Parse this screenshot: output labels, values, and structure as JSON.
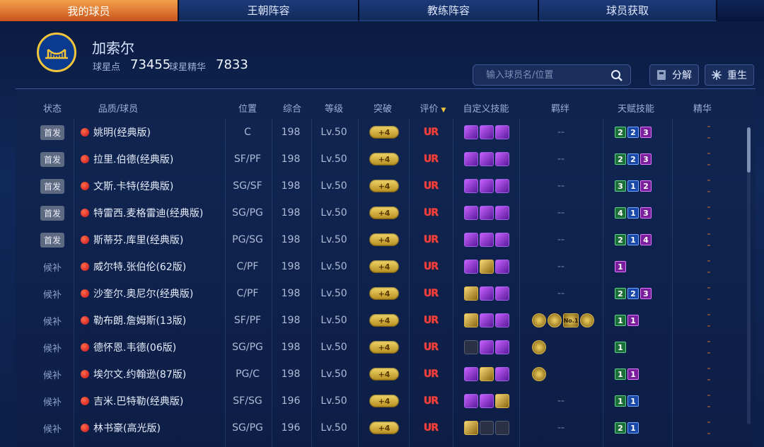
{
  "tabs": [
    {
      "label": "我的球员"
    },
    {
      "label": "王朝阵容"
    },
    {
      "label": "教练阵容"
    },
    {
      "label": "球员获取"
    }
  ],
  "header": {
    "team_name": "加索尔",
    "star_points_label": "球星点",
    "star_points_value": "73455",
    "essence_label": "球星精华",
    "essence_value": "7833"
  },
  "search": {
    "placeholder": "输入球员名/位置"
  },
  "buttons": {
    "split": "分解",
    "reborn": "重生"
  },
  "columns": {
    "status": "状态",
    "quality_player": "品质/球员",
    "position": "位置",
    "overall": "综合",
    "level": "等级",
    "breakthrough": "突破",
    "rating": "评价",
    "custom_skills": "自定义技能",
    "bonds": "羁绊",
    "talent_skills": "天赋技能",
    "essence": "精华"
  },
  "colors": {
    "accent_tab": "#e07a2e",
    "ur_red": "#ff3b3b",
    "gold": "#d8b34a"
  },
  "players": [
    {
      "status": "首发",
      "name": "姚明(经典版)",
      "pos": "C",
      "ovr": "198",
      "lvl": "Lv.50",
      "break": "+4",
      "rating": "UR",
      "bond": "--",
      "talents": [
        "2",
        "2",
        "3"
      ],
      "tc": [
        "g",
        "b",
        "p"
      ],
      "essence": "--"
    },
    {
      "status": "首发",
      "name": "拉里.伯德(经典版)",
      "pos": "SF/PF",
      "ovr": "198",
      "lvl": "Lv.50",
      "break": "+4",
      "rating": "UR",
      "bond": "--",
      "talents": [
        "2",
        "2",
        "3"
      ],
      "tc": [
        "g",
        "b",
        "p"
      ],
      "essence": "--"
    },
    {
      "status": "首发",
      "name": "文斯.卡特(经典版)",
      "pos": "SG/SF",
      "ovr": "198",
      "lvl": "Lv.50",
      "break": "+4",
      "rating": "UR",
      "bond": "--",
      "talents": [
        "3",
        "1",
        "2"
      ],
      "tc": [
        "g",
        "b",
        "p"
      ],
      "essence": "--"
    },
    {
      "status": "首发",
      "name": "特雷西.麦格雷迪(经典版)",
      "pos": "SG/PG",
      "ovr": "198",
      "lvl": "Lv.50",
      "break": "+4",
      "rating": "UR",
      "bond": "--",
      "talents": [
        "4",
        "1",
        "3"
      ],
      "tc": [
        "g",
        "b",
        "p"
      ],
      "essence": "--"
    },
    {
      "status": "首发",
      "name": "斯蒂芬.库里(经典版)",
      "pos": "PG/SG",
      "ovr": "198",
      "lvl": "Lv.50",
      "break": "+4",
      "rating": "UR",
      "bond": "--",
      "talents": [
        "2",
        "1",
        "4"
      ],
      "tc": [
        "g",
        "b",
        "p"
      ],
      "essence": "--"
    },
    {
      "status": "候补",
      "name": "威尔特.张伯伦(62版)",
      "pos": "C/PF",
      "ovr": "198",
      "lvl": "Lv.50",
      "break": "+4",
      "rating": "UR",
      "bond": "--",
      "talents": [
        "1"
      ],
      "tc": [
        "p"
      ],
      "essence": "--"
    },
    {
      "status": "候补",
      "name": "沙奎尔.奥尼尔(经典版)",
      "pos": "C/PF",
      "ovr": "198",
      "lvl": "Lv.50",
      "break": "+4",
      "rating": "UR",
      "bond": "--",
      "talents": [
        "2",
        "2",
        "3"
      ],
      "tc": [
        "g",
        "b",
        "p"
      ],
      "essence": "--"
    },
    {
      "status": "候补",
      "name": "勒布朗.詹姆斯(13版)",
      "pos": "SF/PF",
      "ovr": "198",
      "lvl": "Lv.50",
      "break": "+4",
      "rating": "UR",
      "bond": "",
      "talents": [
        "1",
        "1"
      ],
      "tc": [
        "g",
        "p"
      ],
      "essence": "--"
    },
    {
      "status": "候补",
      "name": "德怀恩.韦德(06版)",
      "pos": "SG/PG",
      "ovr": "198",
      "lvl": "Lv.50",
      "break": "+4",
      "rating": "UR",
      "bond": "",
      "talents": [
        "1"
      ],
      "tc": [
        "g"
      ],
      "essence": "--"
    },
    {
      "status": "候补",
      "name": "埃尔文.约翰逊(87版)",
      "pos": "PG/C",
      "ovr": "198",
      "lvl": "Lv.50",
      "break": "+4",
      "rating": "UR",
      "bond": "",
      "talents": [
        "1",
        "1"
      ],
      "tc": [
        "g",
        "p"
      ],
      "essence": "--"
    },
    {
      "status": "候补",
      "name": "吉米.巴特勒(经典版)",
      "pos": "SF/SG",
      "ovr": "196",
      "lvl": "Lv.50",
      "break": "+4",
      "rating": "UR",
      "bond": "--",
      "talents": [
        "1",
        "1"
      ],
      "tc": [
        "g",
        "b"
      ],
      "essence": "--"
    },
    {
      "status": "候补",
      "name": "林书豪(高光版)",
      "pos": "SG/PG",
      "ovr": "196",
      "lvl": "Lv.50",
      "break": "+4",
      "rating": "UR",
      "bond": "--",
      "talents": [
        "2",
        "1"
      ],
      "tc": [
        "g",
        "b"
      ],
      "essence": "--"
    }
  ],
  "skills": [
    [
      "purple",
      "purple",
      "purple"
    ],
    [
      "purple",
      "purple",
      "purple"
    ],
    [
      "purple",
      "purple",
      "purple"
    ],
    [
      "purple",
      "purple",
      "purple"
    ],
    [
      "purple",
      "purple",
      "purple"
    ],
    [
      "purple",
      "gold",
      "purple"
    ],
    [
      "gold",
      "purple",
      "purple"
    ],
    [
      "gold",
      "purple",
      "purple"
    ],
    [
      "empty",
      "purple",
      "purple"
    ],
    [
      "purple",
      "gold",
      "purple"
    ],
    [
      "purple",
      "purple",
      "gold"
    ],
    [
      "gold",
      "empty",
      "empty"
    ]
  ],
  "bond_icons": [
    0,
    0,
    0,
    0,
    0,
    0,
    0,
    4,
    1,
    1,
    0,
    0
  ],
  "bond_badge_text": "No.1"
}
